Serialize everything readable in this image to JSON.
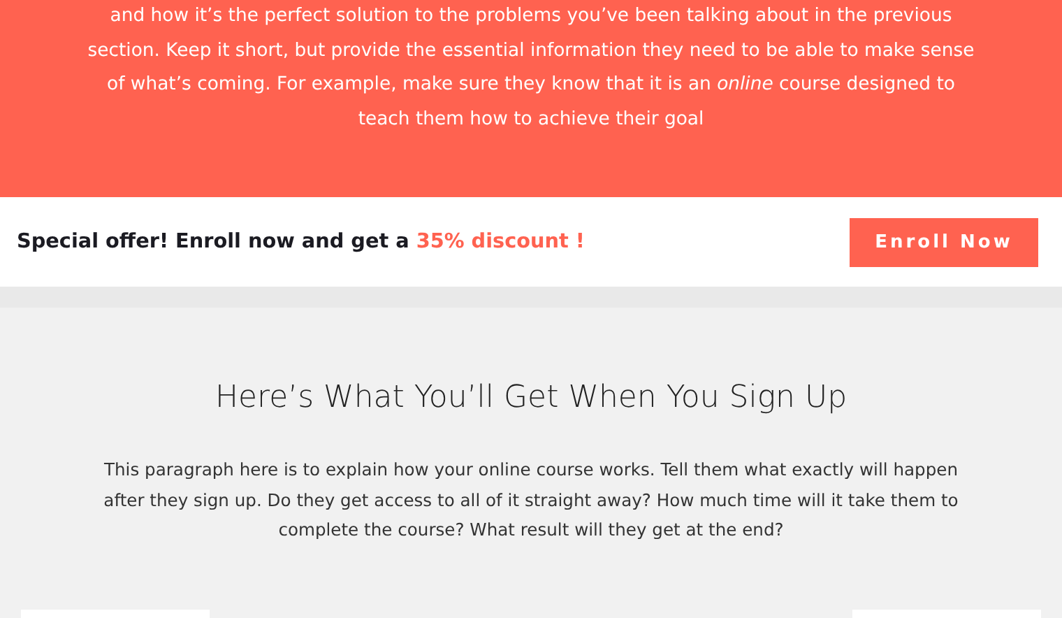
{
  "hero": {
    "paragraph": "and how it’s the perfect solution to the problems you’ve been talking about in the previous section. Keep it short, but provide the essential information they need to be able to make sense of what’s coming. For example, make sure they know that it is an *online* course designed to teach them how to achieve their goal"
  },
  "offer_bar": {
    "text": "Special offer! Enroll now and get a",
    "highlight": "35% discount !",
    "button": "Enroll Now"
  },
  "benefits": {
    "heading": "Here’s What You’ll Get When You Sign Up",
    "paragraph": "This paragraph here is to explain how your online course works. Tell them what exactly will happen after they sign up. Do they get access to all of it straight away? How much time will it take them to complete the course? What result will they get at the end?"
  }
}
